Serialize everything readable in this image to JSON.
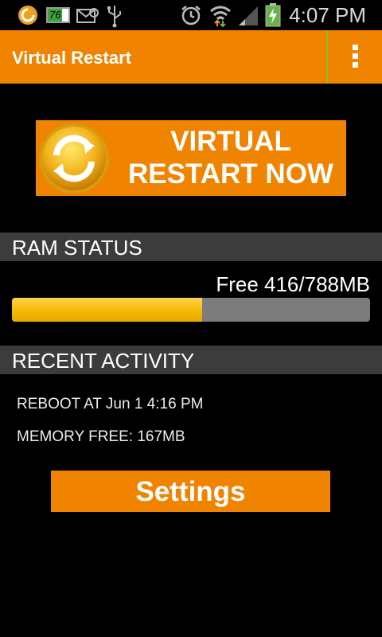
{
  "status_bar": {
    "time": "4:07 PM",
    "battery_badge": "76",
    "icons": [
      "app-notification-icon",
      "battery-76-icon",
      "mail-icon",
      "usb-icon",
      "alarm-icon",
      "wifi-icon",
      "signal-icon",
      "battery-charging-icon"
    ]
  },
  "app_bar": {
    "title": "Virtual Restart",
    "menu_icon": "overflow-menu-icon"
  },
  "restart_button": {
    "line1": "VIRTUAL",
    "line2": "RESTART NOW",
    "icon": "refresh-icon"
  },
  "ram_status": {
    "header": "RAM STATUS",
    "free_text": "Free 416/788MB",
    "used_fraction": 0.53
  },
  "recent_activity": {
    "header": "RECENT ACTIVITY",
    "items": [
      "REBOOT AT Jun 1 4:16 PM",
      "MEMORY FREE: 167MB"
    ]
  },
  "settings_button": {
    "label": "Settings"
  },
  "colors": {
    "accent": "#f08300",
    "header_bg": "#3c3c3c",
    "bar_fill": "#f5b800",
    "bar_track": "#7c7c7c"
  }
}
